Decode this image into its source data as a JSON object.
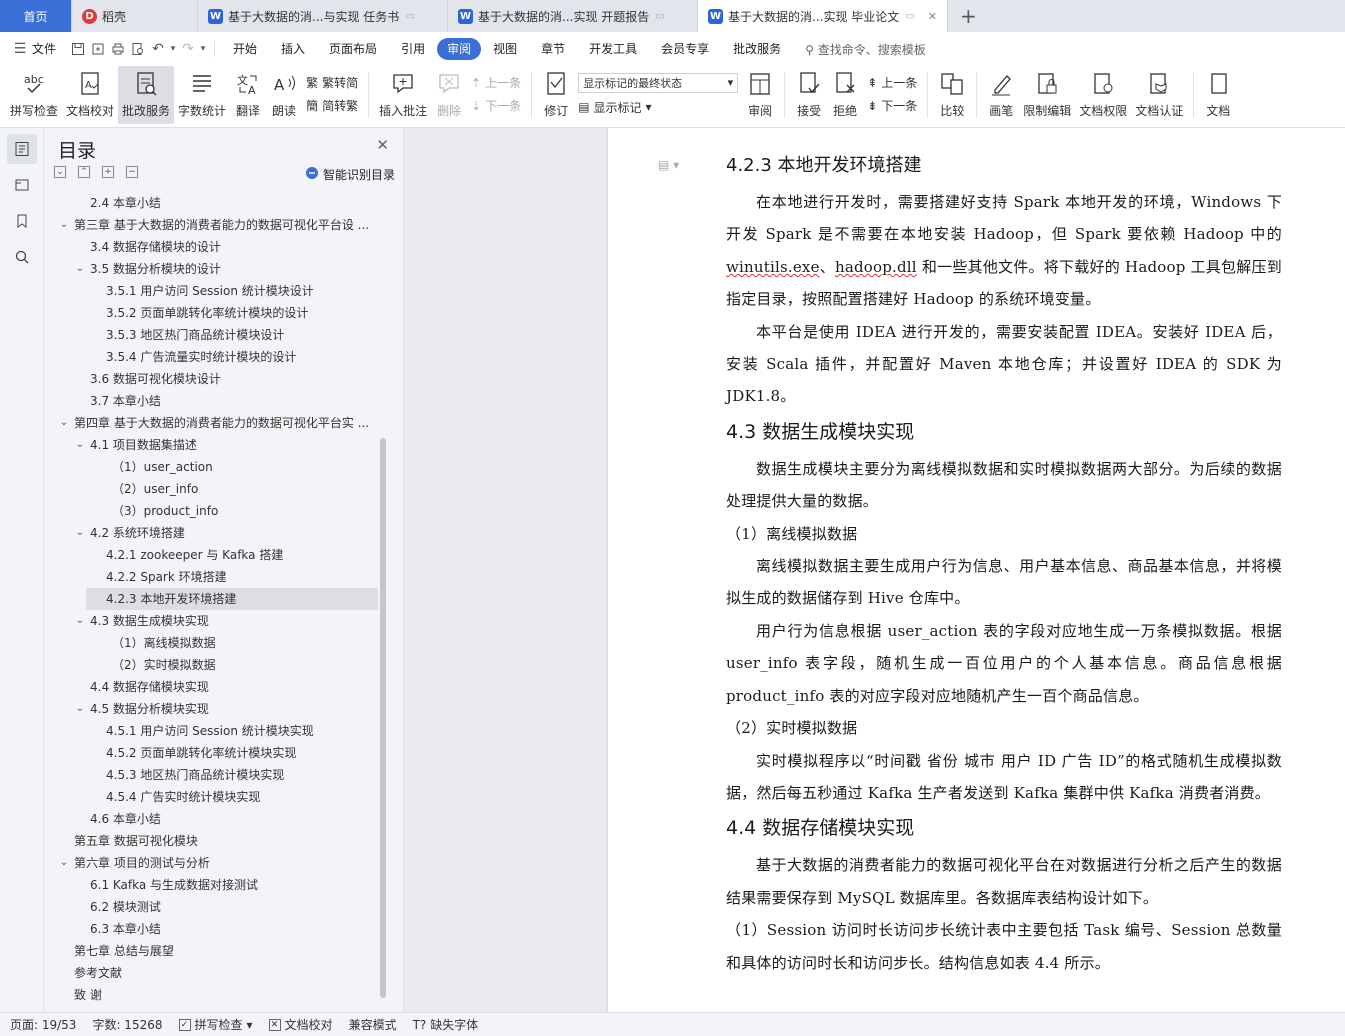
{
  "tabs": [
    {
      "label": "首页",
      "kind": "home",
      "active": false
    },
    {
      "label": "稻壳",
      "kind": "docer",
      "active": false
    },
    {
      "label": "基于大数据的消...与实现 任务书",
      "kind": "doc",
      "active": false
    },
    {
      "label": "基于大数据的消...实现 开题报告",
      "kind": "doc",
      "active": false
    },
    {
      "label": "基于大数据的消...实现 毕业论文",
      "kind": "doc",
      "active": true
    }
  ],
  "menu": {
    "file_label": "文件",
    "items": [
      "开始",
      "插入",
      "页面布局",
      "引用",
      "审阅",
      "视图",
      "章节",
      "开发工具",
      "会员专享",
      "批改服务"
    ],
    "active_item": "审阅",
    "search_placeholder": "查找命令、搜索模板"
  },
  "ribbon": {
    "spell_check": "拼写检查",
    "doc_proof": "文档校对",
    "correction_service": "批改服务",
    "word_count": "字数统计",
    "translate": "翻译",
    "read_aloud": "朗读",
    "simp_to_trad": "繁转简",
    "trad_to_simp": "简转繁",
    "insert_comment": "插入批注",
    "delete": "删除",
    "prev_comment": "上一条",
    "next_comment": "下一条",
    "track_changes": "修订",
    "markup_state": "显示标记的最终状态",
    "show_markup": "显示标记",
    "review": "审阅",
    "accept": "接受",
    "reject": "拒绝",
    "prev_change": "上一条",
    "next_change": "下一条",
    "compare": "比较",
    "pen": "画笔",
    "restrict_edit": "限制编辑",
    "doc_permission": "文档权限",
    "doc_certify": "文档认证",
    "overflow": "文档"
  },
  "toc": {
    "title": "目录",
    "smart_label": "智能识别目录",
    "items": [
      {
        "text": "2.4  本章小结",
        "level": 2,
        "arrow": ""
      },
      {
        "text": "第三章  基于大数据的消费者能力的数据可视化平台设 ...",
        "level": 1,
        "arrow": "down"
      },
      {
        "text": "3.4 数据存储模块的设计",
        "level": 2,
        "arrow": ""
      },
      {
        "text": "3.5 数据分析模块的设计",
        "level": 2,
        "arrow": "down"
      },
      {
        "text": "3.5.1  用户访问 Session 统计模块设计",
        "level": 3,
        "arrow": ""
      },
      {
        "text": "3.5.2  页面单跳转化率统计模块的设计",
        "level": 3,
        "arrow": ""
      },
      {
        "text": "3.5.3  地区热门商品统计模块设计",
        "level": 3,
        "arrow": ""
      },
      {
        "text": "3.5.4 广告流量实时统计模块的设计",
        "level": 3,
        "arrow": ""
      },
      {
        "text": "3.6 数据可视化模块设计",
        "level": 2,
        "arrow": ""
      },
      {
        "text": "3.7  本章小结",
        "level": 2,
        "arrow": ""
      },
      {
        "text": "第四章  基于大数据的消费者能力的数据可视化平台实 ...",
        "level": 1,
        "arrow": "down"
      },
      {
        "text": "4.1 项目数据集描述",
        "level": 2,
        "arrow": "down"
      },
      {
        "text": "（1）user_action",
        "level": 4,
        "arrow": ""
      },
      {
        "text": "（2）user_info",
        "level": 4,
        "arrow": ""
      },
      {
        "text": "（3）product_info",
        "level": 4,
        "arrow": ""
      },
      {
        "text": "4.2 系统环境搭建",
        "level": 2,
        "arrow": "down"
      },
      {
        "text": "4.2.1 zookeeper 与 Kafka 搭建",
        "level": 3,
        "arrow": ""
      },
      {
        "text": "4.2.2 Spark 环境搭建",
        "level": 3,
        "arrow": ""
      },
      {
        "text": "4.2.3 本地开发环境搭建",
        "level": 3,
        "arrow": "",
        "selected": true
      },
      {
        "text": "4.3 数据生成模块实现",
        "level": 2,
        "arrow": "down"
      },
      {
        "text": "（1）离线模拟数据",
        "level": 4,
        "arrow": ""
      },
      {
        "text": "（2）实时模拟数据",
        "level": 4,
        "arrow": ""
      },
      {
        "text": "4.4 数据存储模块实现",
        "level": 2,
        "arrow": ""
      },
      {
        "text": "4.5 数据分析模块实现",
        "level": 2,
        "arrow": "down"
      },
      {
        "text": "4.5.1 用户访问 Session 统计模块实现",
        "level": 3,
        "arrow": ""
      },
      {
        "text": "4.5.2 页面单跳转化率统计模块实现",
        "level": 3,
        "arrow": ""
      },
      {
        "text": "4.5.3 地区热门商品统计模块实现",
        "level": 3,
        "arrow": ""
      },
      {
        "text": "4.5.4 广告实时统计模块实现",
        "level": 3,
        "arrow": ""
      },
      {
        "text": "4.6  本章小结",
        "level": 2,
        "arrow": ""
      },
      {
        "text": "第五章  数据可视化模块",
        "level": 1,
        "arrow": ""
      },
      {
        "text": "第六章  项目的测试与分析",
        "level": 1,
        "arrow": "down"
      },
      {
        "text": "6.1 Kafka 与生成数据对接测试",
        "level": 2,
        "arrow": ""
      },
      {
        "text": "6.2 模块测试",
        "level": 2,
        "arrow": ""
      },
      {
        "text": "6.3 本章小结",
        "level": 2,
        "arrow": ""
      },
      {
        "text": "第七章  总结与展望",
        "level": 1,
        "arrow": ""
      },
      {
        "text": "参考文献",
        "level": 1,
        "arrow": ""
      },
      {
        "text": "致    谢",
        "level": 1,
        "arrow": ""
      }
    ]
  },
  "document": {
    "h_423": "4.2.3 本地开发环境搭建",
    "p1a": "在本地进行开发时，需要搭建好支持 Spark 本地开发的环境，Windows 下开发 Spark 是不需要在本地安装 Hadoop，但 Spark 要依赖 Hadoop 中的 ",
    "p1_u1": "winutils.exe",
    "p1b": "、",
    "p1_u2": "hadoop.dll",
    "p1c": " 和一些其他文件。将下载好的 Hadoop 工具包解压到指定目录，按照配置搭建好 Hadoop 的系统环境变量。",
    "p2": "本平台是使用 IDEA 进行开发的，需要安装配置 IDEA。安装好 IDEA 后，安装 Scala 插件，并配置好 Maven 本地仓库；并设置好 IDEA 的 SDK 为 JDK1.8。",
    "h_43": "4.3 数据生成模块实现",
    "p3": "数据生成模块主要分为离线模拟数据和实时模拟数据两大部分。为后续的数据处理提供大量的数据。",
    "s1": "（1）离线模拟数据",
    "p4": "离线模拟数据主要生成用户行为信息、用户基本信息、商品基本信息，并将模拟生成的数据储存到 Hive 仓库中。",
    "p5": "用户行为信息根据 user_action 表的字段对应地生成一万条模拟数据。根据 user_info 表字段，随机生成一百位用户的个人基本信息。商品信息根据 product_info 表的对应字段对应地随机产生一百个商品信息。",
    "s2": "（2）实时模拟数据",
    "p6": "实时模拟程序以“时间戳 省份 城市 用户 ID 广告 ID”的格式随机生成模拟数据，然后每五秒通过 Kafka 生产者发送到 Kafka 集群中供 Kafka 消费者消费。",
    "h_44": "4.4 数据存储模块实现",
    "p7": "基于大数据的消费者能力的数据可视化平台在对数据进行分析之后产生的数据结果需要保存到 MySQL 数据库里。各数据库表结构设计如下。",
    "p8": "（1）Session 访问时长访问步长统计表中主要包括 Task 编号、Session 总数量和具体的访问时长和访问步长。结构信息如表 4.4 所示。"
  },
  "status": {
    "page": "页面: 19/53",
    "words": "字数: 15268",
    "spell_check": "拼写检查",
    "doc_proof": "文档校对",
    "compat_mode": "兼容模式",
    "missing_fonts": "缺失字体"
  },
  "colors": {
    "accent": "#3b6fd8",
    "wps_word_blue": "#2b65d9",
    "docer_red": "#e23a3a"
  }
}
